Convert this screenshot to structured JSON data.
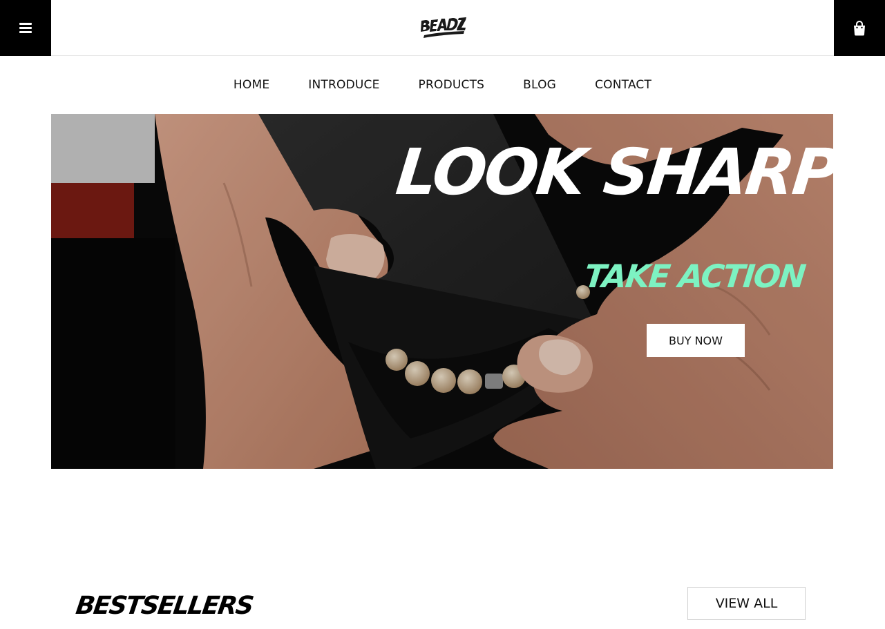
{
  "header": {
    "menu_icon": "hamburger-icon",
    "cart_icon": "shopping-bag-icon",
    "logo_text": "BEADZ"
  },
  "nav": {
    "items": [
      {
        "label": "HOME"
      },
      {
        "label": "INTRODUCE"
      },
      {
        "label": "PRODUCTS"
      },
      {
        "label": "BLOG"
      },
      {
        "label": "CONTACT"
      }
    ]
  },
  "hero": {
    "title": "LOOK SHARP",
    "subtitle": "TAKE ACTION",
    "cta_label": "BUY NOW",
    "subtitle_color": "#7df2c2"
  },
  "bestsellers": {
    "title": "BESTSELLERS",
    "view_all_label": "VIEW ALL"
  }
}
